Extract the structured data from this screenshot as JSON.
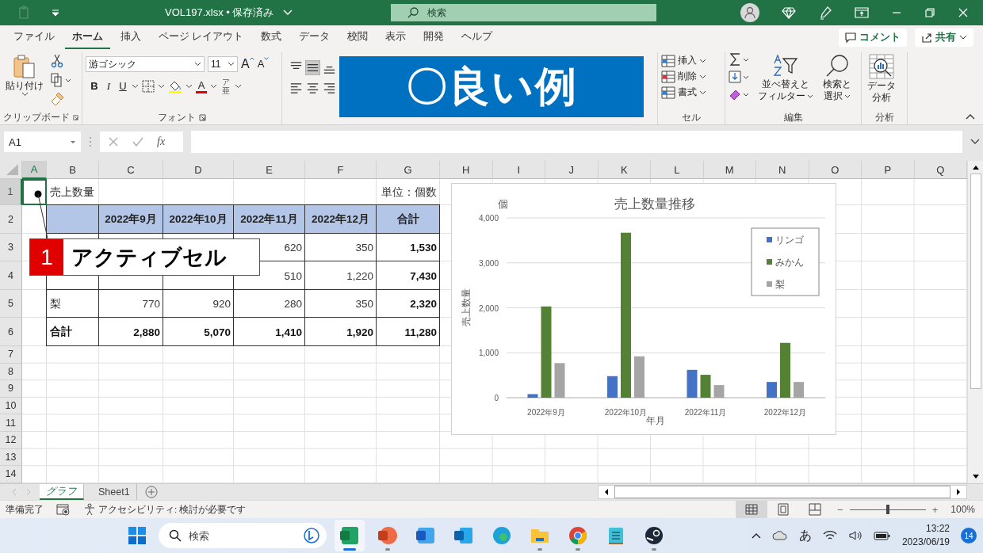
{
  "window": {
    "title": "VOL197.xlsx • 保存済み",
    "search_placeholder": "検索"
  },
  "menu_tabs": [
    {
      "label": "ファイル",
      "selected": false
    },
    {
      "label": "ホーム",
      "selected": true
    },
    {
      "label": "挿入",
      "selected": false
    },
    {
      "label": "ページ レイアウト",
      "selected": false
    },
    {
      "label": "数式",
      "selected": false
    },
    {
      "label": "データ",
      "selected": false
    },
    {
      "label": "校閲",
      "selected": false
    },
    {
      "label": "表示",
      "selected": false
    },
    {
      "label": "開発",
      "selected": false
    },
    {
      "label": "ヘルプ",
      "selected": false
    }
  ],
  "comment_button": "コメント",
  "share_button": "共有",
  "ribbon": {
    "clipboard": {
      "paste": "貼り付け",
      "label": "クリップボード"
    },
    "font": {
      "name": "游ゴシック",
      "size": "11",
      "grow": "A",
      "shrink": "A",
      "bold": "B",
      "italic": "I",
      "underline": "U",
      "font_color": "A",
      "phonetic_top": "ア",
      "phonetic_bottom": "亜",
      "label": "フォント"
    },
    "alignment": [
      {
        "kind": "top",
        "selected": false
      },
      {
        "kind": "middle",
        "selected": true
      },
      {
        "kind": "bottom",
        "selected": false
      },
      {
        "kind": "left",
        "selected": false
      },
      {
        "kind": "center",
        "selected": false
      },
      {
        "kind": "right",
        "selected": false
      }
    ],
    "cells": {
      "items": [
        {
          "kind": "insert",
          "label": "挿入"
        },
        {
          "kind": "delete",
          "label": "削除"
        },
        {
          "kind": "format",
          "label": "書式"
        }
      ],
      "label": "セル"
    },
    "editing": {
      "sort": [
        "並べ替えと",
        "フィルター"
      ],
      "find": [
        "検索と",
        "選択"
      ],
      "label": "編集"
    },
    "analysis": {
      "button": [
        "データ",
        "分析"
      ],
      "label": "分析"
    }
  },
  "banner": {
    "text": "〇良い例"
  },
  "formula_bar": {
    "name_box": "A1",
    "fx": "fx"
  },
  "sheet": {
    "column_headers": [
      {
        "label": "A",
        "selected": true
      },
      {
        "label": "B",
        "selected": false
      },
      {
        "label": "C",
        "selected": false
      },
      {
        "label": "D",
        "selected": false
      },
      {
        "label": "E",
        "selected": false
      },
      {
        "label": "F",
        "selected": false
      },
      {
        "label": "G",
        "selected": false
      },
      {
        "label": "H",
        "selected": false
      },
      {
        "label": "I",
        "selected": false
      },
      {
        "label": "J",
        "selected": false
      },
      {
        "label": "K",
        "selected": false
      },
      {
        "label": "L",
        "selected": false
      },
      {
        "label": "M",
        "selected": false
      },
      {
        "label": "N",
        "selected": false
      },
      {
        "label": "O",
        "selected": false
      },
      {
        "label": "P",
        "selected": false
      },
      {
        "label": "Q",
        "selected": false
      }
    ],
    "row_headers": [
      {
        "label": "1",
        "selected": true
      },
      {
        "label": "2",
        "selected": false
      },
      {
        "label": "3",
        "selected": false
      },
      {
        "label": "4",
        "selected": false
      },
      {
        "label": "5",
        "selected": false
      },
      {
        "label": "6",
        "selected": false
      },
      {
        "label": "7",
        "selected": false
      },
      {
        "label": "8",
        "selected": false
      },
      {
        "label": "9",
        "selected": false
      },
      {
        "label": "10",
        "selected": false
      },
      {
        "label": "11",
        "selected": false
      },
      {
        "label": "12",
        "selected": false
      },
      {
        "label": "13",
        "selected": false
      },
      {
        "label": "14",
        "selected": false
      }
    ],
    "title": "売上数量",
    "unit": "単位：個数",
    "table": {
      "columns": [
        "2022年9月",
        "2022年10月",
        "2022年11月",
        "2022年12月",
        "合計"
      ],
      "rows": [
        {
          "kind": "covered",
          "values": [
            "620",
            "350",
            "1,530"
          ]
        },
        {
          "kind": "covered",
          "values": [
            "510",
            "1,220",
            "7,430"
          ]
        },
        {
          "kind": "item",
          "label": "梨",
          "values": [
            "770",
            "920",
            "280",
            "350",
            "2,320"
          ]
        },
        {
          "kind": "total",
          "label": "合計",
          "values": [
            "2,880",
            "5,070",
            "1,410",
            "1,920",
            "11,280"
          ]
        }
      ]
    }
  },
  "callout": {
    "number": "1",
    "text": "アクティブセル"
  },
  "chart": {
    "unit": "個",
    "chart_data": {
      "type": "bar",
      "title": "売上数量推移",
      "xlabel": "年月",
      "ylabel": "売上数量",
      "categories": [
        "2022年9月",
        "2022年10月",
        "2022年11月",
        "2022年12月"
      ],
      "series": [
        {
          "name": "リンゴ",
          "color": "#4472c4",
          "values": [
            80,
            480,
            620,
            350
          ]
        },
        {
          "name": "みかん",
          "color": "#548235",
          "values": [
            2030,
            3670,
            510,
            1220
          ]
        },
        {
          "name": "梨",
          "color": "#a5a5a5",
          "values": [
            770,
            920,
            280,
            350
          ]
        }
      ],
      "ylim": [
        0,
        4000
      ],
      "grid": true,
      "legend": true,
      "yticks": [
        {
          "value": 0,
          "label": "0"
        },
        {
          "value": 1000,
          "label": "1,000"
        },
        {
          "value": 2000,
          "label": "2,000"
        },
        {
          "value": 3000,
          "label": "3,000"
        },
        {
          "value": 4000,
          "label": "4,000"
        }
      ]
    }
  },
  "sheet_tabs": [
    {
      "label": "グラフ",
      "selected": true
    },
    {
      "label": "Sheet1",
      "selected": false
    }
  ],
  "status_bar": {
    "ready": "準備完了",
    "accessibility": "アクセシビリティ: 検討が必要です",
    "views": [
      {
        "kind": "normal",
        "selected": true
      },
      {
        "kind": "page",
        "selected": false
      },
      {
        "kind": "break",
        "selected": false
      }
    ],
    "zoom": {
      "minus": "−",
      "plus": "+",
      "level": 0.5,
      "reading": "100%"
    }
  },
  "taskbar": {
    "search_placeholder": "検索",
    "apps": [
      {
        "kind": "spreadsheet",
        "selected": true,
        "running": true
      },
      {
        "kind": "presentation",
        "selected": false,
        "running": true
      },
      {
        "kind": "document",
        "selected": false,
        "running": false
      },
      {
        "kind": "mail",
        "selected": false,
        "running": false
      },
      {
        "kind": "edge",
        "selected": false,
        "running": false
      },
      {
        "kind": "folder",
        "selected": false,
        "running": true
      },
      {
        "kind": "chrome",
        "selected": false,
        "running": true
      },
      {
        "kind": "notepad",
        "selected": false,
        "running": false
      },
      {
        "kind": "steam",
        "selected": false,
        "running": true
      }
    ],
    "ime": "あ",
    "time": "13:22",
    "date": "2023/06/19",
    "badge": "14"
  }
}
